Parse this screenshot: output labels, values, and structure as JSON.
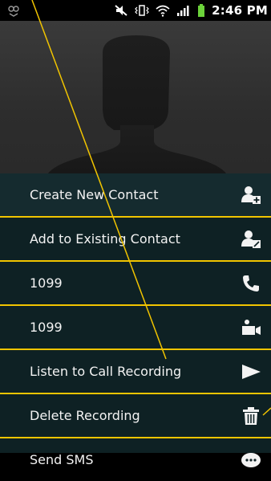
{
  "status_bar": {
    "time": "2:46 PM",
    "icons": [
      "notification-icon",
      "mute-icon",
      "vibrate-icon",
      "wifi-icon",
      "signal-icon",
      "battery-icon"
    ]
  },
  "contact": {
    "avatar_icon": "default-contact-silhouette"
  },
  "menu": {
    "items": [
      {
        "label": "Create New Contact",
        "icon": "add-contact-icon"
      },
      {
        "label": "Add to Existing Contact",
        "icon": "edit-contact-icon"
      },
      {
        "label": "1099",
        "icon": "phone-icon"
      },
      {
        "label": "1099",
        "icon": "video-call-icon"
      },
      {
        "label": "Listen to Call Recording",
        "icon": "play-icon"
      },
      {
        "label": "Delete Recording",
        "icon": "trash-icon"
      },
      {
        "label": "Send SMS",
        "icon": "message-icon"
      }
    ]
  },
  "colors": {
    "highlight_line": "#f1c400",
    "menu_bg": "#0e2124",
    "text": "#f3f3f3"
  }
}
